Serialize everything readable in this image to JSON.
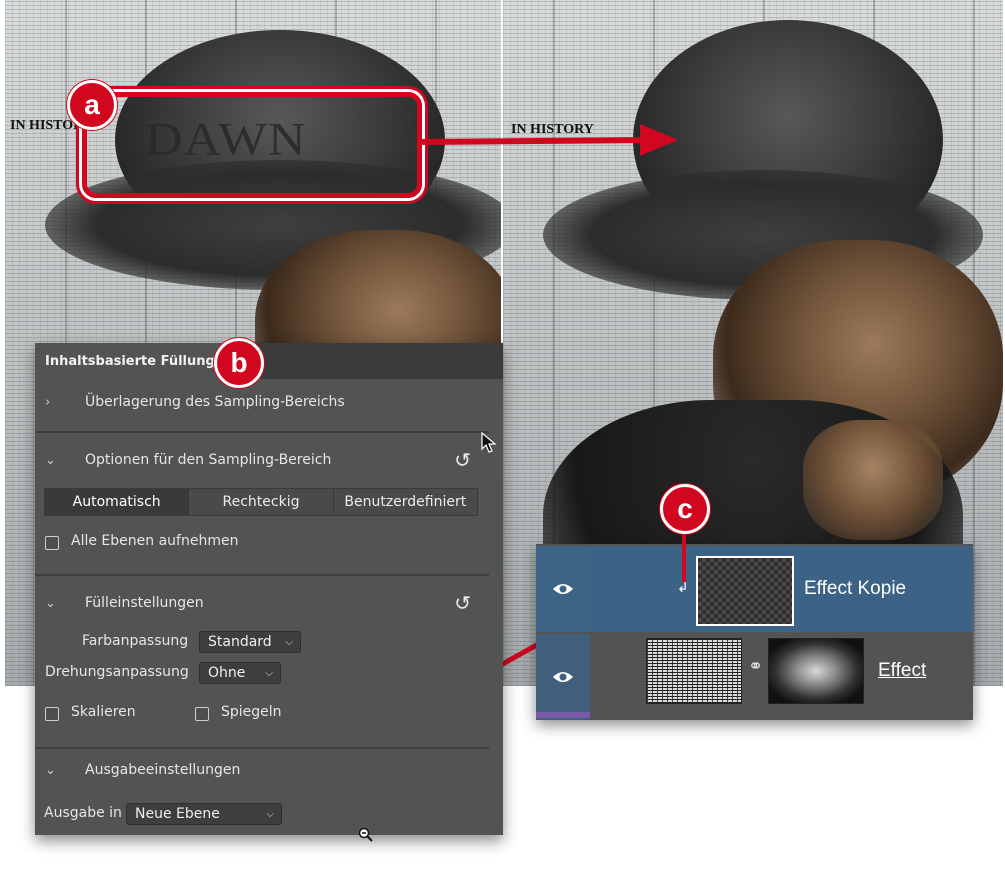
{
  "artwork": {
    "headline_left": "IN HISTORY",
    "headline_right": "IN HISTORY",
    "dawn_text": "DAWN"
  },
  "badges": {
    "a": "a",
    "b": "b",
    "c": "c"
  },
  "accent_color": "#d0071e",
  "fill_panel": {
    "tab_title": "Inhaltsbasierte Füllung",
    "sections": {
      "overlay": "Überlagerung des Sampling-Bereichs",
      "sampling": "Optionen für den Sampling-Bereich",
      "fill": "Fülleinstellungen",
      "output": "Ausgabeeinstellungen"
    },
    "sampling_modes": [
      "Automatisch",
      "Rechteckig",
      "Benutzerdefiniert"
    ],
    "sampling_active": "Automatisch",
    "all_layers_label": "Alle Ebenen aufnehmen",
    "color_adapt_label": "Farbanpassung",
    "color_adapt_value": "Standard",
    "rotation_adapt_label": "Drehungsanpassung",
    "rotation_adapt_value": "Ohne",
    "scale_label": "Skalieren",
    "mirror_label": "Spiegeln",
    "output_label": "Ausgabe in",
    "output_value": "Neue Ebene"
  },
  "layers_panel": {
    "layers": [
      {
        "name": "Effect Kopie",
        "selected": true
      },
      {
        "name": "Effect",
        "selected": false
      }
    ]
  }
}
